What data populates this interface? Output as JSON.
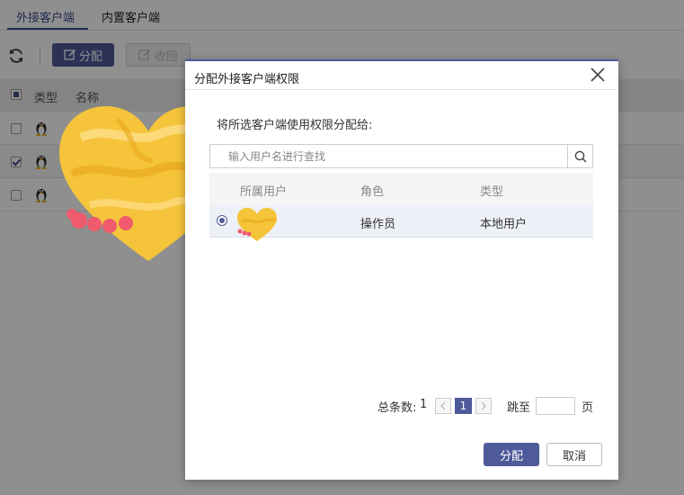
{
  "tabs": [
    {
      "label": "外接客户端",
      "active": true
    },
    {
      "label": "内置客户端",
      "active": false
    }
  ],
  "toolbar": {
    "refresh_icon": "refresh-icon",
    "assign_label": "分配",
    "revoke_label": "收回"
  },
  "table": {
    "columns": [
      "类型",
      "名称"
    ],
    "rows": [
      {
        "type_icon": "linux-tux-icon",
        "checked": false
      },
      {
        "type_icon": "linux-tux-icon",
        "checked": true
      },
      {
        "type_icon": "linux-tux-icon",
        "checked": false
      }
    ]
  },
  "dialog": {
    "title": "分配外接客户端权限",
    "description": "将所选客户端使用权限分配给:",
    "search_placeholder": "输入用户名进行查找",
    "columns": [
      "所属用户",
      "角色",
      "类型"
    ],
    "rows": [
      {
        "selected": true,
        "user": "",
        "role": "操作员",
        "type": "本地用户"
      }
    ],
    "pager": {
      "total_label": "总条数:",
      "total": "1",
      "current_page": "1",
      "jump_label": "跳至",
      "page_unit": "页"
    },
    "ok_label": "分配",
    "cancel_label": "取消"
  },
  "colors": {
    "accent": "#4e5a9a",
    "overlay": "#000000",
    "heart": "#f5c43a",
    "heart_ribbon": "#ef5a6e"
  }
}
